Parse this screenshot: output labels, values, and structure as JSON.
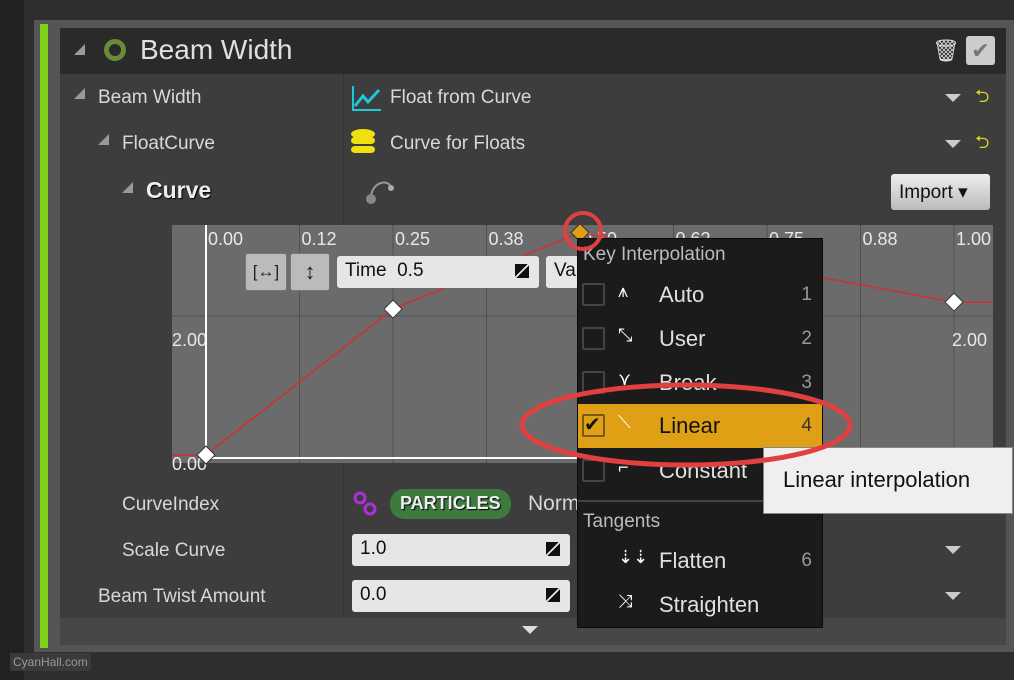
{
  "header": {
    "title": "Beam Width"
  },
  "rows": {
    "beam_width": {
      "label": "Beam Width",
      "value": "Float from Curve"
    },
    "float_curve": {
      "label": "FloatCurve",
      "value": "Curve for Floats"
    },
    "curve": {
      "label": "Curve",
      "import_label": "Import"
    },
    "curve_index": {
      "label": "CurveIndex",
      "badge": "PARTICLES",
      "value": "Norm"
    },
    "scale_curve": {
      "label": "Scale Curve",
      "value": "1.0"
    },
    "beam_twist": {
      "label": "Beam Twist Amount",
      "value": "0.0"
    }
  },
  "curve_editor": {
    "time_label": "Time",
    "time_value": "0.5",
    "value_label": "Va",
    "x_ticks": [
      "0.00",
      "0.12",
      "0.25",
      "0.38",
      "0.50",
      "0.62",
      "0.75",
      "0.88",
      "1.00"
    ],
    "y_ticks": [
      "0.00",
      "2.00"
    ],
    "keys": [
      {
        "time": 0,
        "value": 0
      },
      {
        "time": 0.25,
        "value": 2.1
      },
      {
        "time": 0.5,
        "value": 3.2,
        "selected": true
      },
      {
        "time": 1.0,
        "value": 2.2
      }
    ],
    "curve_color": "#d03030",
    "selected_key_color": "#e0a015"
  },
  "menu": {
    "section1": "Key Interpolation",
    "items": [
      {
        "label": "Auto",
        "key": "1",
        "checked": false,
        "icon": "auto-tangent-icon"
      },
      {
        "label": "User",
        "key": "2",
        "checked": false,
        "icon": "user-tangent-icon"
      },
      {
        "label": "Break",
        "key": "3",
        "checked": false,
        "icon": "break-tangent-icon"
      },
      {
        "label": "Linear",
        "key": "4",
        "checked": true,
        "icon": "linear-interp-icon"
      },
      {
        "label": "Constant",
        "key": "",
        "checked": false,
        "icon": "constant-interp-icon"
      }
    ],
    "section2": "Tangents",
    "tangents": [
      {
        "label": "Flatten",
        "key": "6",
        "icon": "flatten-icon"
      },
      {
        "label": "Straighten",
        "key": "",
        "icon": "straighten-icon"
      }
    ],
    "highlight_color": "#e0a015"
  },
  "tooltip": "Linear interpolation",
  "watermark": "CyanHall.com",
  "colors": {
    "accent_green": "#7fd21a",
    "badge_green": "#3e7a3e",
    "annotation_red": "#e04040"
  }
}
